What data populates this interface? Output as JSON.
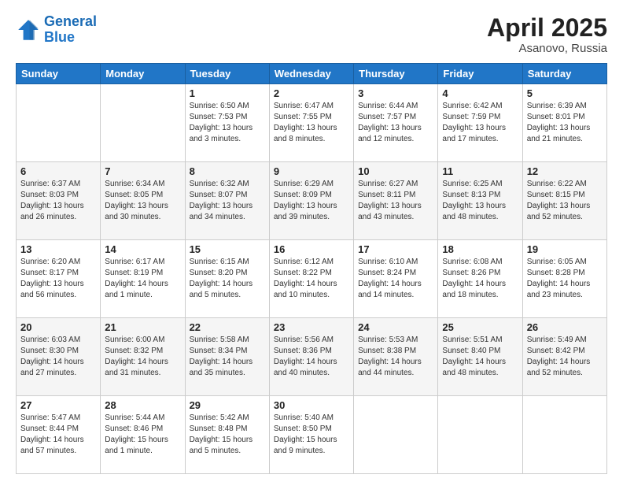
{
  "header": {
    "logo_line1": "General",
    "logo_line2": "Blue",
    "month_year": "April 2025",
    "location": "Asanovo, Russia"
  },
  "weekdays": [
    "Sunday",
    "Monday",
    "Tuesday",
    "Wednesday",
    "Thursday",
    "Friday",
    "Saturday"
  ],
  "weeks": [
    [
      {
        "day": "",
        "info": ""
      },
      {
        "day": "",
        "info": ""
      },
      {
        "day": "1",
        "info": "Sunrise: 6:50 AM\nSunset: 7:53 PM\nDaylight: 13 hours\nand 3 minutes."
      },
      {
        "day": "2",
        "info": "Sunrise: 6:47 AM\nSunset: 7:55 PM\nDaylight: 13 hours\nand 8 minutes."
      },
      {
        "day": "3",
        "info": "Sunrise: 6:44 AM\nSunset: 7:57 PM\nDaylight: 13 hours\nand 12 minutes."
      },
      {
        "day": "4",
        "info": "Sunrise: 6:42 AM\nSunset: 7:59 PM\nDaylight: 13 hours\nand 17 minutes."
      },
      {
        "day": "5",
        "info": "Sunrise: 6:39 AM\nSunset: 8:01 PM\nDaylight: 13 hours\nand 21 minutes."
      }
    ],
    [
      {
        "day": "6",
        "info": "Sunrise: 6:37 AM\nSunset: 8:03 PM\nDaylight: 13 hours\nand 26 minutes."
      },
      {
        "day": "7",
        "info": "Sunrise: 6:34 AM\nSunset: 8:05 PM\nDaylight: 13 hours\nand 30 minutes."
      },
      {
        "day": "8",
        "info": "Sunrise: 6:32 AM\nSunset: 8:07 PM\nDaylight: 13 hours\nand 34 minutes."
      },
      {
        "day": "9",
        "info": "Sunrise: 6:29 AM\nSunset: 8:09 PM\nDaylight: 13 hours\nand 39 minutes."
      },
      {
        "day": "10",
        "info": "Sunrise: 6:27 AM\nSunset: 8:11 PM\nDaylight: 13 hours\nand 43 minutes."
      },
      {
        "day": "11",
        "info": "Sunrise: 6:25 AM\nSunset: 8:13 PM\nDaylight: 13 hours\nand 48 minutes."
      },
      {
        "day": "12",
        "info": "Sunrise: 6:22 AM\nSunset: 8:15 PM\nDaylight: 13 hours\nand 52 minutes."
      }
    ],
    [
      {
        "day": "13",
        "info": "Sunrise: 6:20 AM\nSunset: 8:17 PM\nDaylight: 13 hours\nand 56 minutes."
      },
      {
        "day": "14",
        "info": "Sunrise: 6:17 AM\nSunset: 8:19 PM\nDaylight: 14 hours\nand 1 minute."
      },
      {
        "day": "15",
        "info": "Sunrise: 6:15 AM\nSunset: 8:20 PM\nDaylight: 14 hours\nand 5 minutes."
      },
      {
        "day": "16",
        "info": "Sunrise: 6:12 AM\nSunset: 8:22 PM\nDaylight: 14 hours\nand 10 minutes."
      },
      {
        "day": "17",
        "info": "Sunrise: 6:10 AM\nSunset: 8:24 PM\nDaylight: 14 hours\nand 14 minutes."
      },
      {
        "day": "18",
        "info": "Sunrise: 6:08 AM\nSunset: 8:26 PM\nDaylight: 14 hours\nand 18 minutes."
      },
      {
        "day": "19",
        "info": "Sunrise: 6:05 AM\nSunset: 8:28 PM\nDaylight: 14 hours\nand 23 minutes."
      }
    ],
    [
      {
        "day": "20",
        "info": "Sunrise: 6:03 AM\nSunset: 8:30 PM\nDaylight: 14 hours\nand 27 minutes."
      },
      {
        "day": "21",
        "info": "Sunrise: 6:00 AM\nSunset: 8:32 PM\nDaylight: 14 hours\nand 31 minutes."
      },
      {
        "day": "22",
        "info": "Sunrise: 5:58 AM\nSunset: 8:34 PM\nDaylight: 14 hours\nand 35 minutes."
      },
      {
        "day": "23",
        "info": "Sunrise: 5:56 AM\nSunset: 8:36 PM\nDaylight: 14 hours\nand 40 minutes."
      },
      {
        "day": "24",
        "info": "Sunrise: 5:53 AM\nSunset: 8:38 PM\nDaylight: 14 hours\nand 44 minutes."
      },
      {
        "day": "25",
        "info": "Sunrise: 5:51 AM\nSunset: 8:40 PM\nDaylight: 14 hours\nand 48 minutes."
      },
      {
        "day": "26",
        "info": "Sunrise: 5:49 AM\nSunset: 8:42 PM\nDaylight: 14 hours\nand 52 minutes."
      }
    ],
    [
      {
        "day": "27",
        "info": "Sunrise: 5:47 AM\nSunset: 8:44 PM\nDaylight: 14 hours\nand 57 minutes."
      },
      {
        "day": "28",
        "info": "Sunrise: 5:44 AM\nSunset: 8:46 PM\nDaylight: 15 hours\nand 1 minute."
      },
      {
        "day": "29",
        "info": "Sunrise: 5:42 AM\nSunset: 8:48 PM\nDaylight: 15 hours\nand 5 minutes."
      },
      {
        "day": "30",
        "info": "Sunrise: 5:40 AM\nSunset: 8:50 PM\nDaylight: 15 hours\nand 9 minutes."
      },
      {
        "day": "",
        "info": ""
      },
      {
        "day": "",
        "info": ""
      },
      {
        "day": "",
        "info": ""
      }
    ]
  ]
}
